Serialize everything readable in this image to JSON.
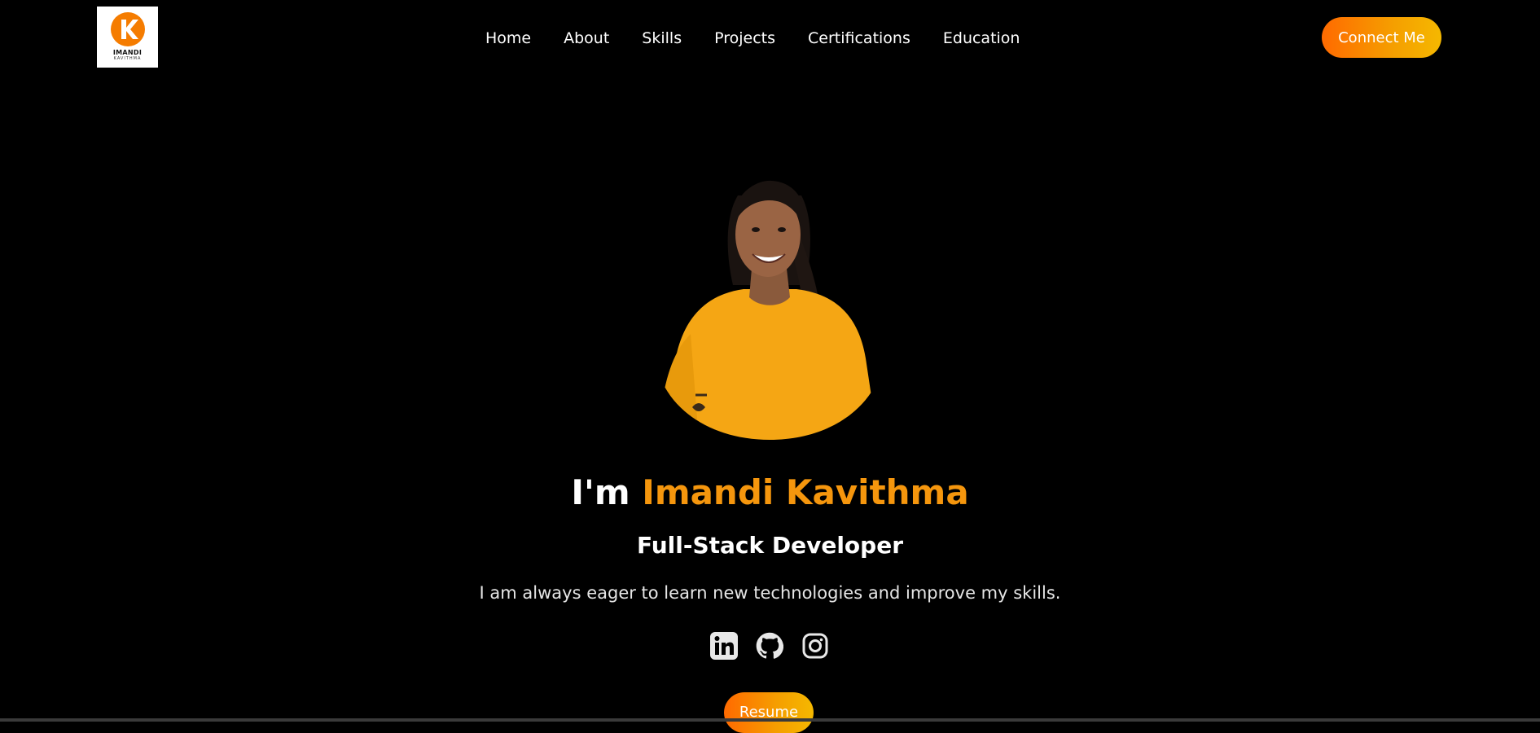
{
  "logo": {
    "letter": "K",
    "name": "IMANDI",
    "subtitle": "KAVITHMA"
  },
  "nav": {
    "items": [
      {
        "label": "Home"
      },
      {
        "label": "About"
      },
      {
        "label": "Skills"
      },
      {
        "label": "Projects"
      },
      {
        "label": "Certifications"
      },
      {
        "label": "Education"
      }
    ],
    "cta_label": "Connect Me"
  },
  "hero": {
    "greeting": "I'm ",
    "name": "Imandi Kavithma",
    "role": "Full-Stack Developer",
    "tagline": "I am always eager to learn new technologies and improve my skills.",
    "resume_label": "Resume"
  },
  "socials": [
    {
      "icon": "linkedin-icon"
    },
    {
      "icon": "github-icon"
    },
    {
      "icon": "instagram-icon"
    }
  ],
  "colors": {
    "background": "#000000",
    "accent": "#f5960d",
    "button_gradient_start": "#ff6a00",
    "button_gradient_end": "#f5b800"
  }
}
